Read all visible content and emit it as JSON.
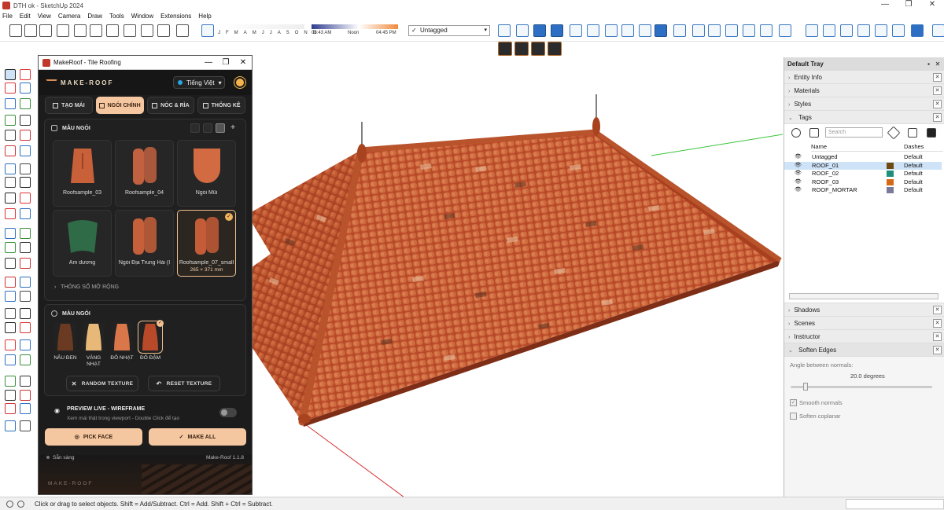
{
  "window": {
    "title": "DTH ok - SketchUp 2024",
    "minimize": "—",
    "restore": "❐",
    "close": "✕"
  },
  "menu": [
    "File",
    "Edit",
    "View",
    "Camera",
    "Draw",
    "Tools",
    "Window",
    "Extensions",
    "Help"
  ],
  "shadow_bar": {
    "months": [
      "J",
      "F",
      "M",
      "A",
      "M",
      "J",
      "J",
      "A",
      "S",
      "O",
      "N",
      "D"
    ],
    "time_start": "06:43 AM",
    "time_noon": "Noon",
    "time_end": "04:45 PM"
  },
  "tag_dropdown": {
    "check": "✓",
    "value": "Untagged",
    "arrow": "▾"
  },
  "status": {
    "message": "Click or drag to select objects. Shift = Add/Subtract. Ctrl = Add. Shift + Ctrl = Subtract."
  },
  "plugin": {
    "title": "MakeRoof - Tile Roofing",
    "brand": "MAKE-ROOF",
    "language": "Tiếng Việt",
    "language_arrow": "▾",
    "tabs": [
      {
        "label": "TẠO MÁI",
        "active": false
      },
      {
        "label": "NGÓI CHÍNH",
        "active": true
      },
      {
        "label": "NÓC & RÌA",
        "active": false
      },
      {
        "label": "THỐNG KÊ",
        "active": false
      }
    ],
    "tile_section": {
      "title": "MẪU NGÓI",
      "add": "+"
    },
    "tiles": [
      {
        "name": "Roofsample_03",
        "size": "",
        "selected": false,
        "color": "#c8603a"
      },
      {
        "name": "Roofsample_04",
        "size": "",
        "selected": false,
        "color": "#c2613f"
      },
      {
        "name": "Ngói Mũi",
        "size": "",
        "selected": false,
        "color": "#d26b42"
      },
      {
        "name": "Âm dương",
        "size": "",
        "selected": false,
        "color": "#2f6b46"
      },
      {
        "name": "Ngói Địa Trung Hải (I",
        "size": "",
        "selected": false,
        "color": "#c5603a"
      },
      {
        "name": "Roofsample_07_small",
        "size": "265 × 371 mm",
        "selected": true,
        "color": "#c45c37"
      }
    ],
    "selected_badge": "✓",
    "advanced": "THÔNG SỐ MỞ RỘNG",
    "advanced_arrow": "›",
    "color_section": {
      "title": "MÀU NGÓI"
    },
    "colors": [
      {
        "label": "NÂU ĐEN",
        "hex": "#6b3a22",
        "selected": false
      },
      {
        "label": "VÀNG NHẠT",
        "hex": "#e8b878",
        "selected": false
      },
      {
        "label": "ĐỎ NHẠT",
        "hex": "#d9774a",
        "selected": false
      },
      {
        "label": "ĐỎ ĐẬM",
        "hex": "#b84a2a",
        "selected": true
      }
    ],
    "random_texture": "RANDOM TEXTURE",
    "random_icon": "✕",
    "reset_texture": "RESET TEXTURE",
    "reset_icon": "↶",
    "preview_title": "PREVIEW LIVE - WIREFRAME",
    "preview_sub": "Xem mái thật trong viewport - Double Click để tạo",
    "preview_icon": "◉",
    "pick_face": "PICK FACE",
    "pick_icon": "◎",
    "make_all": "MAKE ALL",
    "make_icon": "✓",
    "status": "Sẵn sàng",
    "version": "Make-Roof 1.1.8",
    "footer_brand": "MAKE-ROOF",
    "accent": "#f4c7a0"
  },
  "tray": {
    "title": "Default Tray",
    "pin": "▪",
    "close": "✕",
    "top_panels": [
      "Entity Info",
      "Materials",
      "Styles"
    ],
    "tags_title": "Tags",
    "collapsed_arrow": "›",
    "expanded_arrow": "⌄",
    "panel_close": "✕",
    "tag_search_placeholder": "Search",
    "tag_col_name": "Name",
    "tag_col_dashes": "Dashes",
    "tags": [
      {
        "name": "Untagged",
        "color": "",
        "dashes": "Default",
        "selected": false
      },
      {
        "name": "ROOF_01",
        "color": "#6e4a10",
        "dashes": "Default",
        "selected": true
      },
      {
        "name": "ROOF_02",
        "color": "#1f8f7a",
        "dashes": "Default",
        "selected": false
      },
      {
        "name": "ROOF_03",
        "color": "#d46a18",
        "dashes": "Default",
        "selected": false
      },
      {
        "name": "ROOF_MORTAR",
        "color": "#7a7a9a",
        "dashes": "Default",
        "selected": false
      }
    ],
    "eye_icon": "👁",
    "bottom_panels": [
      "Shadows",
      "Scenes",
      "Instructor"
    ],
    "soften_title": "Soften Edges",
    "angle_label": "Angle between normals:",
    "angle_value": "20.0  degrees",
    "smooth_normals": "Smooth normals",
    "soften_coplanar": "Soften coplanar",
    "checked": "✓"
  }
}
